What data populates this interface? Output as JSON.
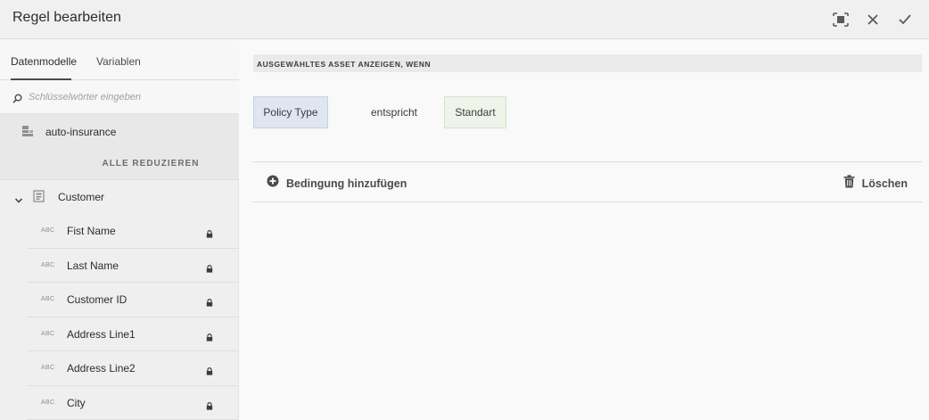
{
  "header": {
    "title": "Regel bearbeiten",
    "icons": {
      "fullscreen": "fullscreen-icon",
      "close": "close-icon",
      "done": "check-icon"
    }
  },
  "sidebar": {
    "tabs": [
      {
        "label": "Datenmodelle",
        "active": true
      },
      {
        "label": "Variablen",
        "active": false
      }
    ],
    "search": {
      "placeholder": "Schlüsselwörter eingeben",
      "value": ""
    },
    "model": {
      "label": "auto-insurance",
      "icon": "data-model-icon"
    },
    "collapse_all_label": "ALLE REDUZIEREN",
    "entity": {
      "label": "Customer",
      "icon": "entity-icon",
      "expanded": true
    },
    "fields": [
      {
        "type": "ABC",
        "label": "Fist Name",
        "locked": true
      },
      {
        "type": "ABC",
        "label": "Last Name",
        "locked": true
      },
      {
        "type": "ABC",
        "label": "Customer ID",
        "locked": true
      },
      {
        "type": "ABC",
        "label": "Address Line1",
        "locked": true
      },
      {
        "type": "ABC",
        "label": "Address Line2",
        "locked": true
      },
      {
        "type": "ABC",
        "label": "City",
        "locked": true
      }
    ]
  },
  "main": {
    "section_title": "AUSGEWÄHLTES ASSET ANZEIGEN, WENN",
    "condition": {
      "field": "Policy Type",
      "operator": "entspricht",
      "value": "Standart"
    },
    "add_condition_label": "Bedingung hinzufügen",
    "delete_label": "Löschen"
  },
  "colors": {
    "header_bg": "#f0f0f0",
    "sidebar_bg": "#efefef",
    "field_chip_bg": "#dfe6f0",
    "value_chip_bg": "#eef4ea"
  }
}
